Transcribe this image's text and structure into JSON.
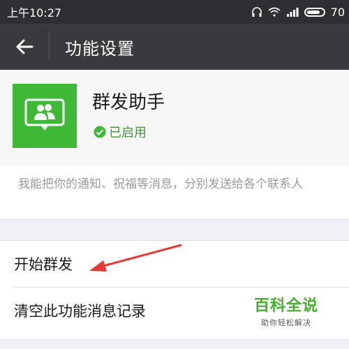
{
  "status_bar": {
    "time": "上午10:27",
    "battery": "70"
  },
  "header": {
    "title": "功能设置"
  },
  "feature": {
    "name": "群发助手",
    "status": "已启用",
    "description": "我能把你的通知、祝福等消息，分别发送给各个联系人"
  },
  "actions": [
    {
      "label": "开始群发"
    },
    {
      "label": "清空此功能消息记录"
    }
  ],
  "watermark": {
    "main": "百科全说",
    "sub": "助你轻松解决"
  },
  "colors": {
    "header": "#3a3a3e",
    "accent_green": "#3fb838",
    "annotation_red": "#e53935"
  }
}
